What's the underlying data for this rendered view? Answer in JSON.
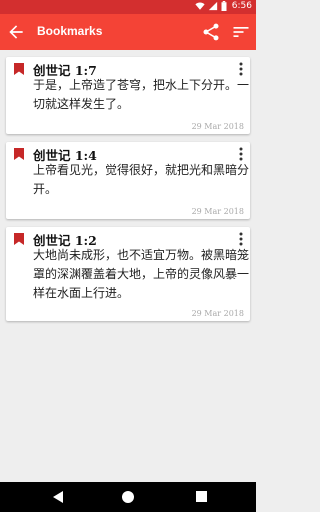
{
  "status": {
    "time": "6:56"
  },
  "appbar": {
    "title": "Bookmarks"
  },
  "colors": {
    "primary": "#f44336",
    "primary_dark": "#d32f2f",
    "bookmark": "#c62828"
  },
  "bookmarks": [
    {
      "ref": "创世记 1:7",
      "text": "于是，上帝造了苍穹，把水上下分开。一切就这样发生了。",
      "date": "29 Mar 2018"
    },
    {
      "ref": "创世记 1:4",
      "text": "上帝看见光，觉得很好，就把光和黑暗分开。",
      "date": "29 Mar 2018"
    },
    {
      "ref": "创世记 1:2",
      "text": "大地尚未成形，也不适宜万物。被黑暗笼罩的深渊覆盖着大地，上帝的灵像风暴一样在水面上行进。",
      "date": "29 Mar 2018"
    }
  ],
  "icons": {
    "status": [
      "wifi-icon",
      "signal-icon",
      "battery-icon"
    ],
    "appbar": [
      "back-arrow-icon",
      "share-icon",
      "sort-icon"
    ],
    "card": [
      "bookmark-icon",
      "more-vert-icon"
    ],
    "nav": [
      "nav-back-icon",
      "nav-home-icon",
      "nav-recent-icon"
    ]
  }
}
